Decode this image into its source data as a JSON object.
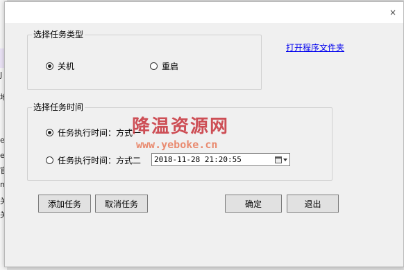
{
  "background": {
    "strip_texts": [
      "地",
      "e",
      "e",
      "官",
      "m",
      "关",
      "关",
      "J"
    ]
  },
  "dialog": {
    "close_icon": "×",
    "task_type": {
      "title": "选择任务类型",
      "options": [
        "关机",
        "重启"
      ],
      "selected": "关机"
    },
    "open_folder_link": "打开程序文件夹",
    "task_time": {
      "title": "选择任务时间",
      "option1": "任务执行时间：方式一",
      "option2": "任务执行时间：方式二",
      "selected": "任务执行时间：方式一",
      "datetime_value": "2018-11-28 21:20:55"
    },
    "buttons": {
      "add": "添加任务",
      "cancel_task": "取消任务",
      "ok": "确定",
      "exit": "退出"
    }
  },
  "watermark": {
    "line1": "降温资源网",
    "line2": "www.yeboke.cn"
  },
  "colors": {
    "watermark_red": "#c8323a",
    "link_blue": "#0000ee"
  }
}
